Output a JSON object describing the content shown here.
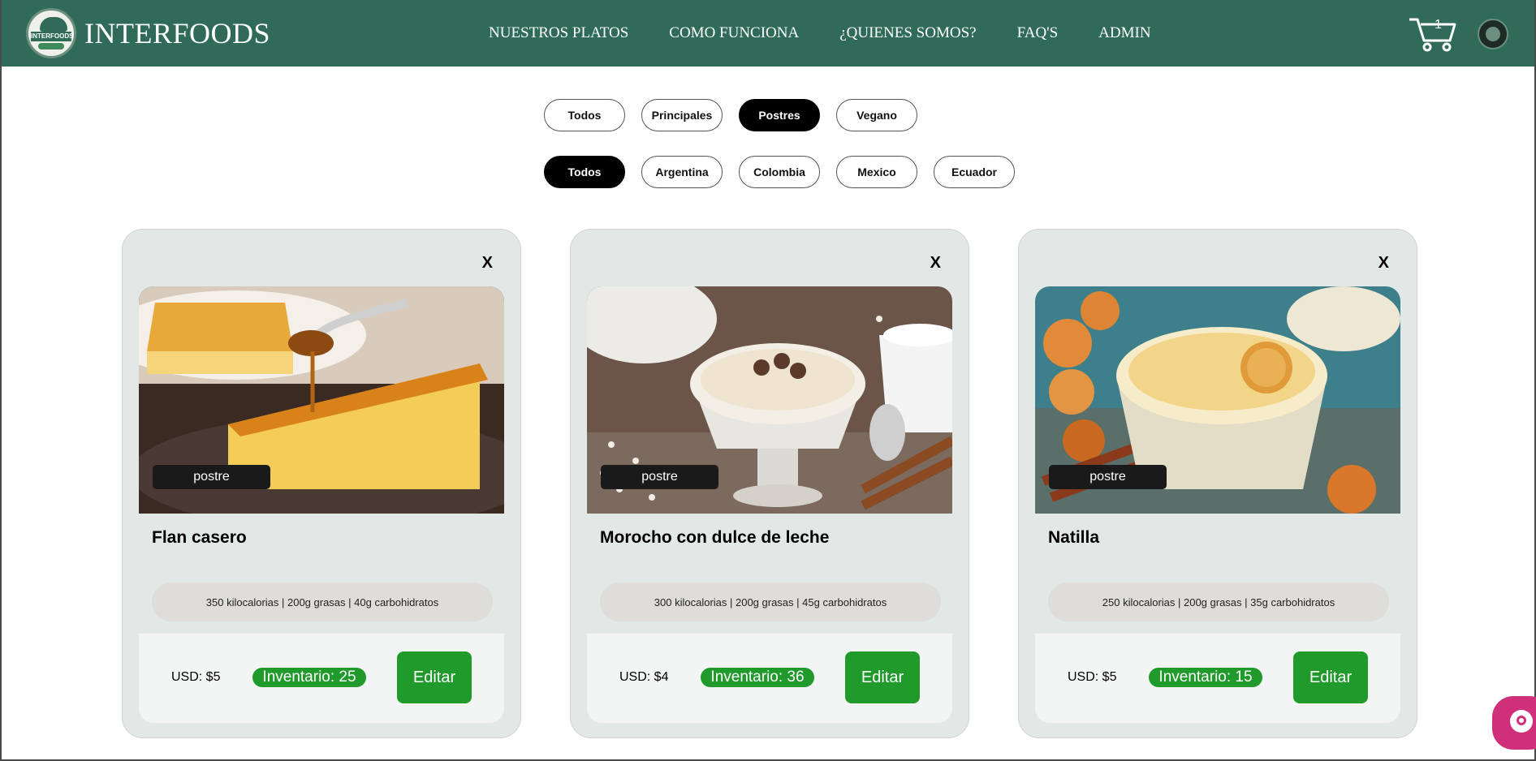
{
  "header": {
    "logo_text": "INTERFOODS",
    "brand_name": "INTERFOODS",
    "nav": [
      "NUESTROS PLATOS",
      "COMO FUNCIONA",
      "¿QUIENES SOMOS?",
      "FAQ'S",
      "ADMIN"
    ],
    "cart_count": "1",
    "cart_icon": "shopping-cart-icon",
    "avatar_icon": "user-avatar"
  },
  "filters": {
    "category": {
      "options": [
        "Todos",
        "Principales",
        "Postres",
        "Vegano"
      ],
      "selected": "Postres"
    },
    "country": {
      "options": [
        "Todos",
        "Argentina",
        "Colombia",
        "Mexico",
        "Ecuador"
      ],
      "selected": "Todos"
    }
  },
  "cards": [
    {
      "close": "X",
      "tag": "postre",
      "title": "Flan casero",
      "nutrition": "350 kilocalorias | 200g grasas | 40g carbohidratos",
      "price": "USD: $5",
      "inventory": "Inventario: 25",
      "edit": "Editar"
    },
    {
      "close": "X",
      "tag": "postre",
      "title": "Morocho con dulce de leche",
      "nutrition": "300 kilocalorias | 200g grasas | 45g carbohidratos",
      "price": "USD: $4",
      "inventory": "Inventario: 36",
      "edit": "Editar"
    },
    {
      "close": "X",
      "tag": "postre",
      "title": "Natilla",
      "nutrition": "250 kilocalorias | 200g grasas | 35g carbohidratos",
      "price": "USD: $5",
      "inventory": "Inventario: 15",
      "edit": "Editar"
    }
  ],
  "chat": {
    "icon": "chat-support-icon"
  },
  "colors": {
    "header_bg": "#2f6b58",
    "accent_green": "#1f9a2b",
    "chat_pink": "#d0307a",
    "card_bg": "#e2e8e5"
  }
}
